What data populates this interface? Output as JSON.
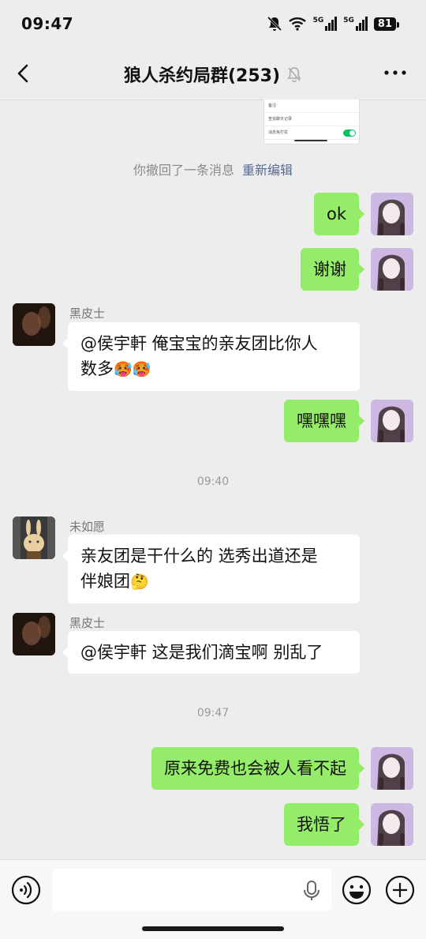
{
  "status_bar": {
    "time": "09:47",
    "signal1_label": "5G",
    "signal2_label": "5G",
    "battery": "81"
  },
  "nav": {
    "title": "狼人杀约局群(253)"
  },
  "screenshot_preview": {
    "rows": [
      "备注",
      "查找聊天记录",
      "消息免打扰"
    ]
  },
  "system": {
    "recall_text": "你撤回了一条消息",
    "reedit_label": "重新编辑"
  },
  "messages": {
    "m1": {
      "text": "ok"
    },
    "m2": {
      "text": "谢谢"
    },
    "m3": {
      "sender": "黑皮士",
      "line1": "@侯宇軒  俺宝宝的亲友团比你人",
      "line2": "数多",
      "emoji": "🥵🥵"
    },
    "m4": {
      "text": "嘿嘿嘿"
    },
    "t1": "09:40",
    "m5": {
      "sender": "未如愿",
      "line1": "亲友团是干什么的 选秀出道还是",
      "line2": "伴娘团",
      "emoji": "🤔"
    },
    "m6": {
      "sender": "黑皮士",
      "text": "@侯宇軒  这是我们滴宝啊 别乱了"
    },
    "t2": "09:47",
    "m7": {
      "text": "原来免费也会被人看不起"
    },
    "m8": {
      "text": "我悟了"
    }
  },
  "input": {
    "placeholder": ""
  },
  "colors": {
    "outgoing_bubble": "#95ec69",
    "incoming_bubble": "#ffffff",
    "link": "#576b95",
    "background": "#ededed"
  },
  "icons": [
    "back-arrow-icon",
    "mute-bell-icon",
    "more-dots-icon",
    "voice-icon",
    "mic-icon",
    "emoji-icon",
    "plus-icon"
  ]
}
